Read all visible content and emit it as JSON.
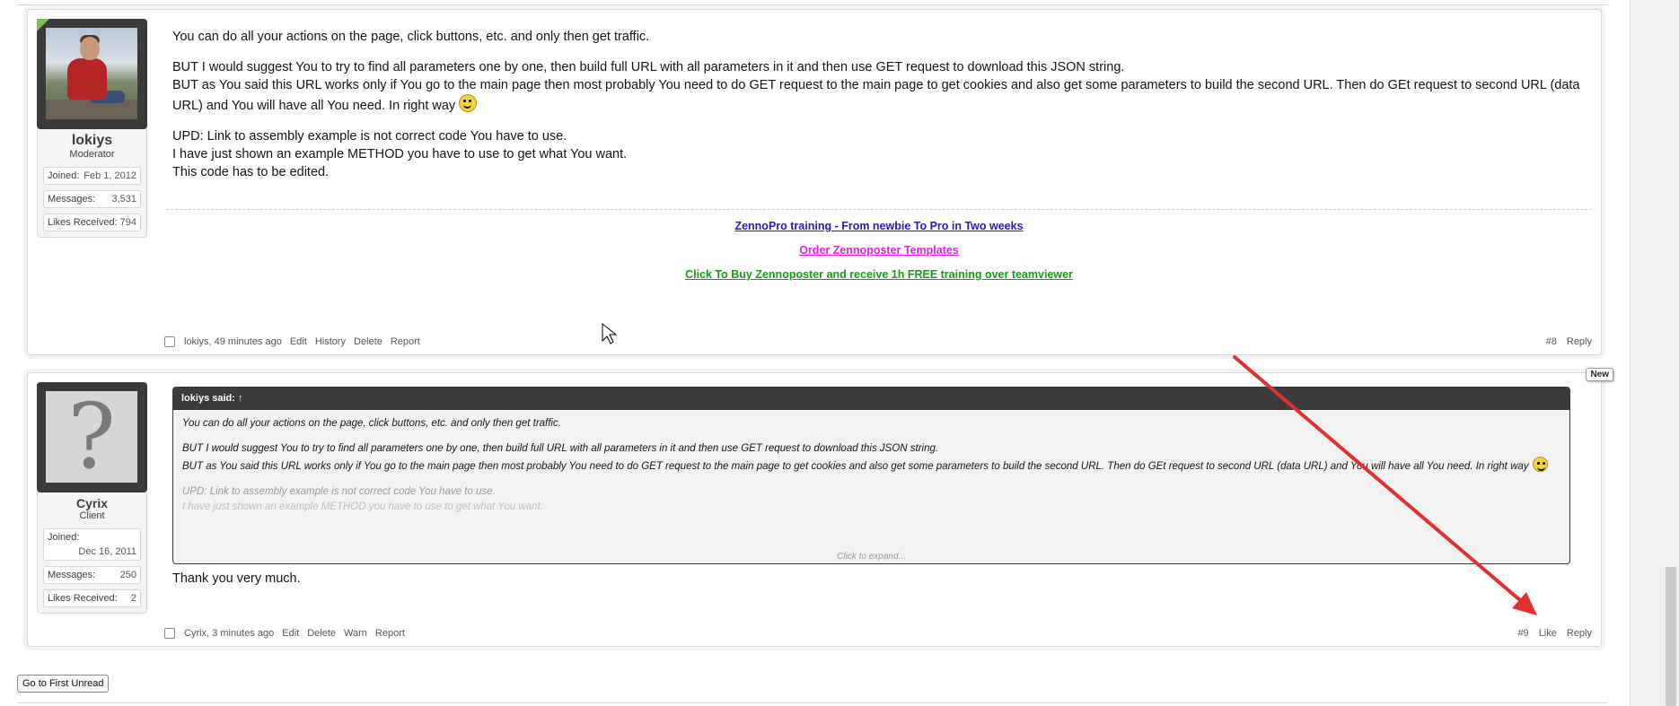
{
  "posts": [
    {
      "user": {
        "name": "lokiys",
        "title": "Moderator",
        "stats": [
          {
            "label": "Joined:",
            "value": "Feb 1, 2012"
          },
          {
            "label": "Messages:",
            "value": "3,531"
          },
          {
            "label": "Likes Received:",
            "value": "794"
          }
        ]
      },
      "body": {
        "line1": "You can do all your actions on the page, click buttons, etc. and only then get traffic.",
        "line2": "BUT I would suggest You to try to find all parameters one by one, then build full URL with all parameters in it and then use GET request to download this JSON string.",
        "line3": "BUT as You said this URL works only if You go to the main page then most probably You need to do GET request to the main page to get cookies and also get some parameters to build the second URL. Then do GEt request to second URL (data URL) and You will have all You need. In right way",
        "line4": "UPD: Link to assembly example is not correct code You have to use.",
        "line5": "I have just shown an example METHOD you have to use to get what You want.",
        "line6": "This code has to be edited."
      },
      "signature": {
        "link1": "ZennoPro training - From newbie To Pro in Two weeks",
        "link2": "Order Zennoposter Templates",
        "link3": "Click To Buy Zennoposter and receive 1h FREE training over teamviewer"
      },
      "meta": {
        "author_time": "lokiys, 49 minutes ago",
        "actions": [
          "Edit",
          "History",
          "Delete",
          "Report"
        ],
        "post_number": "#8",
        "reply": "Reply"
      }
    },
    {
      "user": {
        "name": "Cyrix",
        "title": "Client",
        "stats": [
          {
            "label": "Joined:",
            "value": "Dec 16, 2011"
          },
          {
            "label": "Messages:",
            "value": "250"
          },
          {
            "label": "Likes Received:",
            "value": "2"
          }
        ]
      },
      "new_badge": "New",
      "quote": {
        "header": "lokiys said: ↑",
        "line1": "You can do all your actions on the page, click buttons, etc. and only then get traffic.",
        "line2": "BUT I would suggest You to try to find all parameters one by one, then build full URL with all parameters in it and then use GET request to download this JSON string.",
        "line3": "BUT as You said this URL works only if You go to the main page then most probably You need to do GET request to the main page to get cookies and also get some parameters to build the second URL. Then do GEt request to second URL (data URL) and You will have all You need. In right way",
        "line4": "UPD: Link to assembly example is not correct code You have to use.",
        "line5": "I have just shown an example METHOD you have to use to get what You want.",
        "expand": "Click to expand..."
      },
      "body": "Thank you very much.",
      "meta": {
        "author_time": "Cyrix, 3 minutes ago",
        "actions": [
          "Edit",
          "Delete",
          "Warn",
          "Report"
        ],
        "post_number": "#9",
        "like": "Like",
        "reply": "Reply"
      }
    }
  ],
  "go_first_unread": "Go to First Unread",
  "colors": {
    "annotation_arrow": "#e03030",
    "sig_link1": "#1c1cd4",
    "sig_link2": "#e01ee0",
    "sig_link3": "#12a012"
  }
}
